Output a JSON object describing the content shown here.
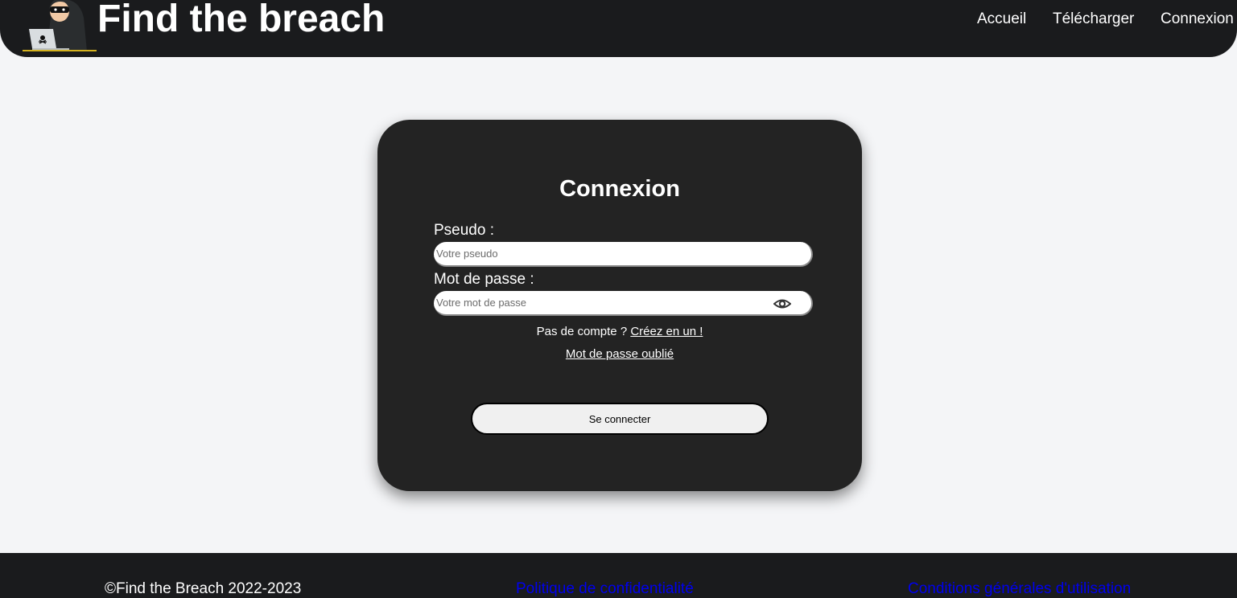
{
  "header": {
    "brand": "Find the breach",
    "nav": [
      {
        "label": "Accueil"
      },
      {
        "label": "Télécharger"
      },
      {
        "label": "Connexion"
      }
    ]
  },
  "login": {
    "title": "Connexion",
    "username_label": "Pseudo :",
    "username_placeholder": "Votre pseudo",
    "username_value": "",
    "password_label": "Mot de passe :",
    "password_placeholder": "Votre mot de passe",
    "password_value": "",
    "password_toggle_icon": "eye-icon",
    "no_account_text": "Pas de compte ? ",
    "create_account_link": "Créez en un !",
    "forgot_password_link": "Mot de passe oublié",
    "submit_label": "Se connecter"
  },
  "footer": {
    "copyright": "©Find the Breach 2022-2023",
    "privacy_link": "Politique de confidentialité",
    "terms_link": "Conditions générales d'utilisation"
  },
  "colors": {
    "header_bg": "#1a1b1d",
    "card_bg": "#232323",
    "page_bg": "#f4f5f7",
    "footer_link": "#0000ee"
  }
}
